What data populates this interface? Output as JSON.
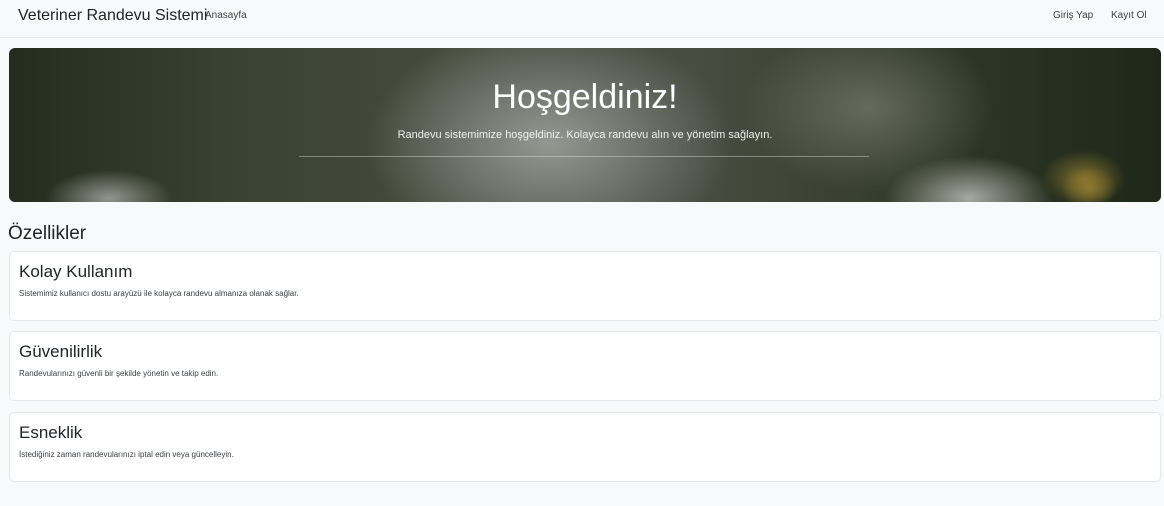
{
  "navbar": {
    "brand": "Veteriner Randevu Sistemi",
    "home": "Anasayfa",
    "login": "Giriş Yap",
    "register": "Kayıt Ol"
  },
  "hero": {
    "title": "Hoşgeldiniz!",
    "subtitle": "Randevu sistemimize hoşgeldiniz. Kolayca randevu alın ve yönetim sağlayın."
  },
  "features": {
    "title": "Özellikler",
    "items": [
      {
        "title": "Kolay Kullanım",
        "text": "Sistemimiz kullanıcı dostu arayüzü ile kolayca randevu almanıza olanak sağlar."
      },
      {
        "title": "Güvenilirlik",
        "text": "Randevularınızı güvenli bir şekilde yönetin ve takip edin."
      },
      {
        "title": "Esneklik",
        "text": "İstediğiniz zaman randevularınızı iptal edin veya güncelleyin."
      }
    ]
  }
}
